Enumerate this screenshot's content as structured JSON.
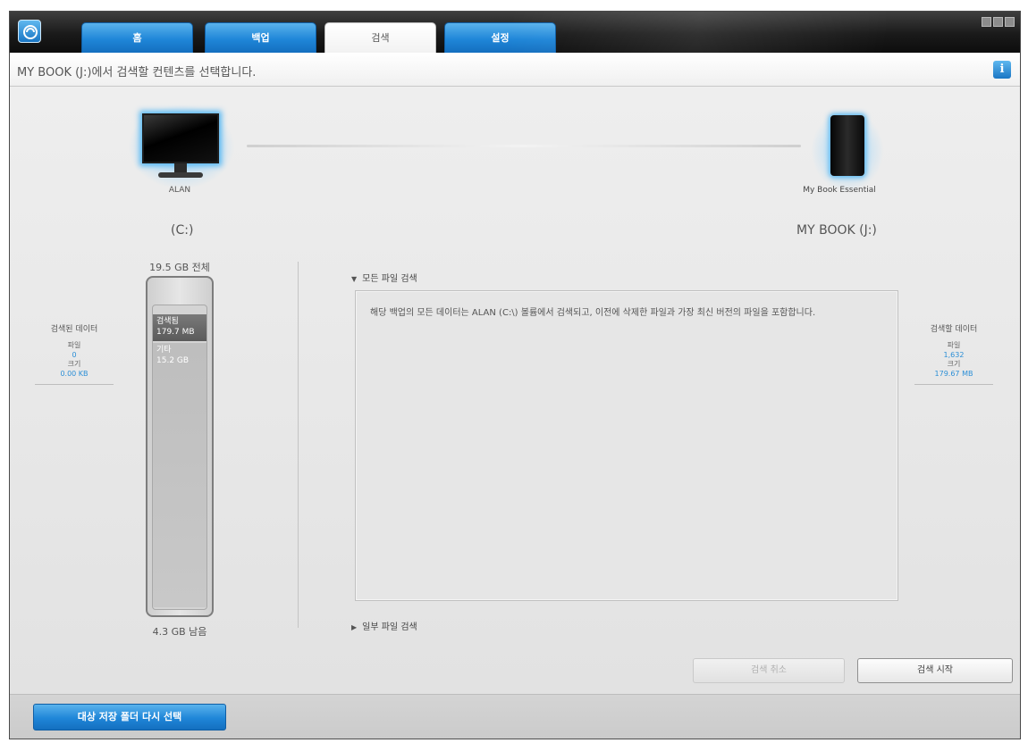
{
  "tabs": [
    {
      "label": "홈"
    },
    {
      "label": "백업"
    },
    {
      "label": "검색"
    },
    {
      "label": "설정"
    }
  ],
  "header": {
    "instruction": "MY BOOK (J:)에서 검색할 컨텐츠를 선택합니다.",
    "info_icon": "i"
  },
  "source": {
    "computer_name": "ALAN",
    "drive": "(C:)",
    "capacity_total": "19.5 GB 전체",
    "segment_restore_label": "검색됨",
    "segment_restore_size": "179.7 MB",
    "segment_other_label": "기타",
    "segment_other_size": "15.2 GB",
    "capacity_free": "4.3 GB 남음"
  },
  "target": {
    "device_name": "My Book Essential",
    "drive": "MY BOOK (J:)"
  },
  "left_stats": {
    "title": "검색된 데이터",
    "files_label": "파일",
    "files_value": "0",
    "size_label": "크기",
    "size_value": "0.00 KB"
  },
  "right_stats": {
    "title": "검색할 데이터",
    "files_label": "파일",
    "files_value": "1,632",
    "size_label": "크기",
    "size_value": "179.67 MB"
  },
  "restore_options": {
    "all_label": "모든 파일 검색",
    "all_description": "해당 백업의 모든 데이터는 ALAN (C:\\) 볼륨에서 검색되고, 이전에 삭제한 파일과 가장 최신 버전의 파일을 포함합니다.",
    "some_label": "일부 파일 검색"
  },
  "buttons": {
    "cancel": "검색 취소",
    "start": "검색 시작",
    "reselect": "대상 저장 폴더 다시 선택"
  },
  "icons": {
    "logo": "wd-logo-icon",
    "info": "info-icon",
    "source": "computer-monitor-icon",
    "target": "external-drive-icon"
  },
  "colors": {
    "accent_blue": "#1f86d8",
    "value_blue": "#2c8fd6"
  }
}
